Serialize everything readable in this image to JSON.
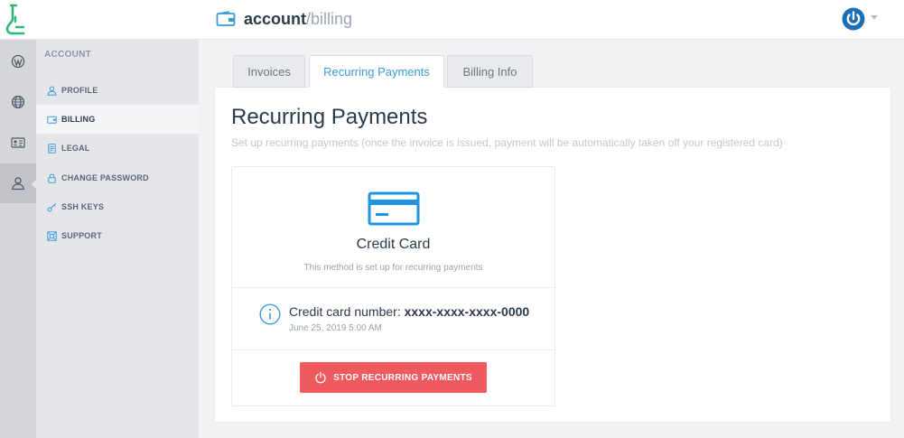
{
  "header": {
    "section": "account",
    "separator": "/",
    "page": "billing"
  },
  "rail": {
    "items": [
      {
        "icon": "wordpress-icon"
      },
      {
        "icon": "globe-icon"
      },
      {
        "icon": "id-card-icon"
      },
      {
        "icon": "user-icon",
        "active": true
      }
    ]
  },
  "sidebar": {
    "title": "ACCOUNT",
    "items": [
      {
        "label": "PROFILE",
        "icon": "user-icon"
      },
      {
        "label": "BILLING",
        "icon": "wallet-icon",
        "active": true
      },
      {
        "label": "LEGAL",
        "icon": "document-icon"
      },
      {
        "label": "CHANGE PASSWORD",
        "icon": "lock-icon"
      },
      {
        "label": "SSH KEYS",
        "icon": "key-icon"
      },
      {
        "label": "SUPPORT",
        "icon": "lifebuoy-icon"
      }
    ]
  },
  "tabs": [
    {
      "label": "Invoices"
    },
    {
      "label": "Recurring Payments",
      "active": true
    },
    {
      "label": "Billing Info"
    }
  ],
  "main": {
    "title": "Recurring Payments",
    "subtitle": "Set up recurring payments (once the invoice is issued, payment will be automatically taken off your registered card)",
    "card": {
      "method_name": "Credit Card",
      "method_note": "This method is set up for recurring payments",
      "number_label": "Credit card number:",
      "number_value": "xxxx-xxxx-xxxx-0000",
      "date": "June 25, 2019 5:00 AM",
      "stop_button": "STOP RECURRING PAYMENTS"
    }
  },
  "colors": {
    "accent": "#3a9bd9",
    "danger": "#f0595e",
    "logo": "#2fb77a",
    "power": "#1a6fb8"
  }
}
